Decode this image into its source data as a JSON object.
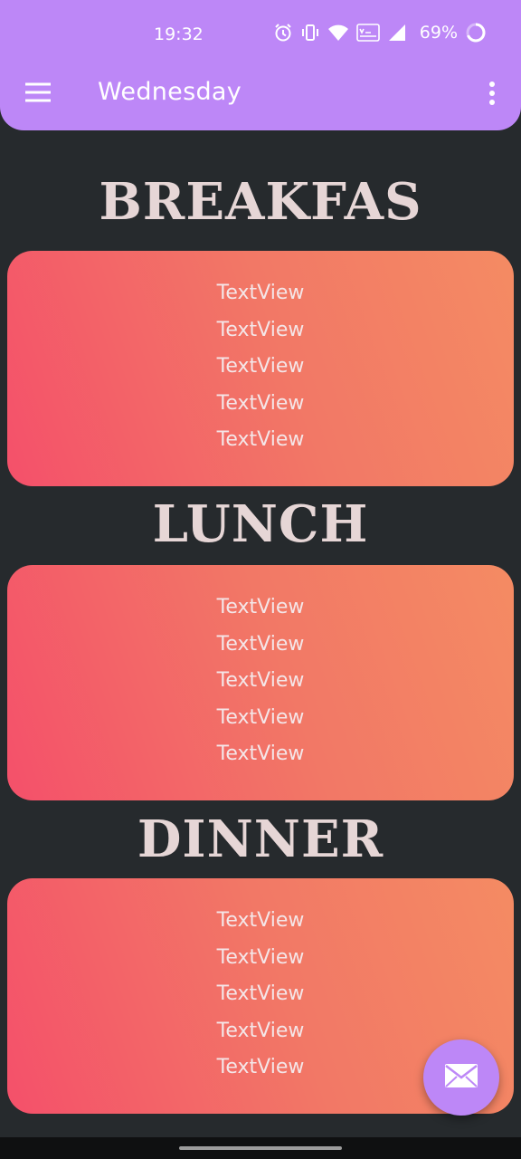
{
  "status_bar": {
    "time": "19:32",
    "battery_percent": "69%",
    "icons": [
      "alarm-icon",
      "vibrate-icon",
      "wifi-icon",
      "vowifi-icon",
      "signal-icon",
      "battery-icon"
    ]
  },
  "app_bar": {
    "title": "Wednesday",
    "menu_icon": "hamburger-menu-icon",
    "overflow_icon": "more-vert-icon",
    "color": "#bd87f7"
  },
  "sections": [
    {
      "title": "BREAKFAS",
      "items": [
        "TextView",
        "TextView",
        "TextView",
        "TextView",
        "TextView"
      ]
    },
    {
      "title": "LUNCH",
      "items": [
        "TextView",
        "TextView",
        "TextView",
        "TextView",
        "TextView"
      ]
    },
    {
      "title": "DINNER",
      "items": [
        "TextView",
        "TextView",
        "TextView",
        "TextView",
        "TextView"
      ]
    }
  ],
  "fab": {
    "icon": "mail-icon",
    "color": "#bd87f7"
  },
  "colors": {
    "background": "#262a2d",
    "card_gradient_start": "#f4506a",
    "card_gradient_end": "#f48b63",
    "section_title": "#e6d6d6"
  }
}
